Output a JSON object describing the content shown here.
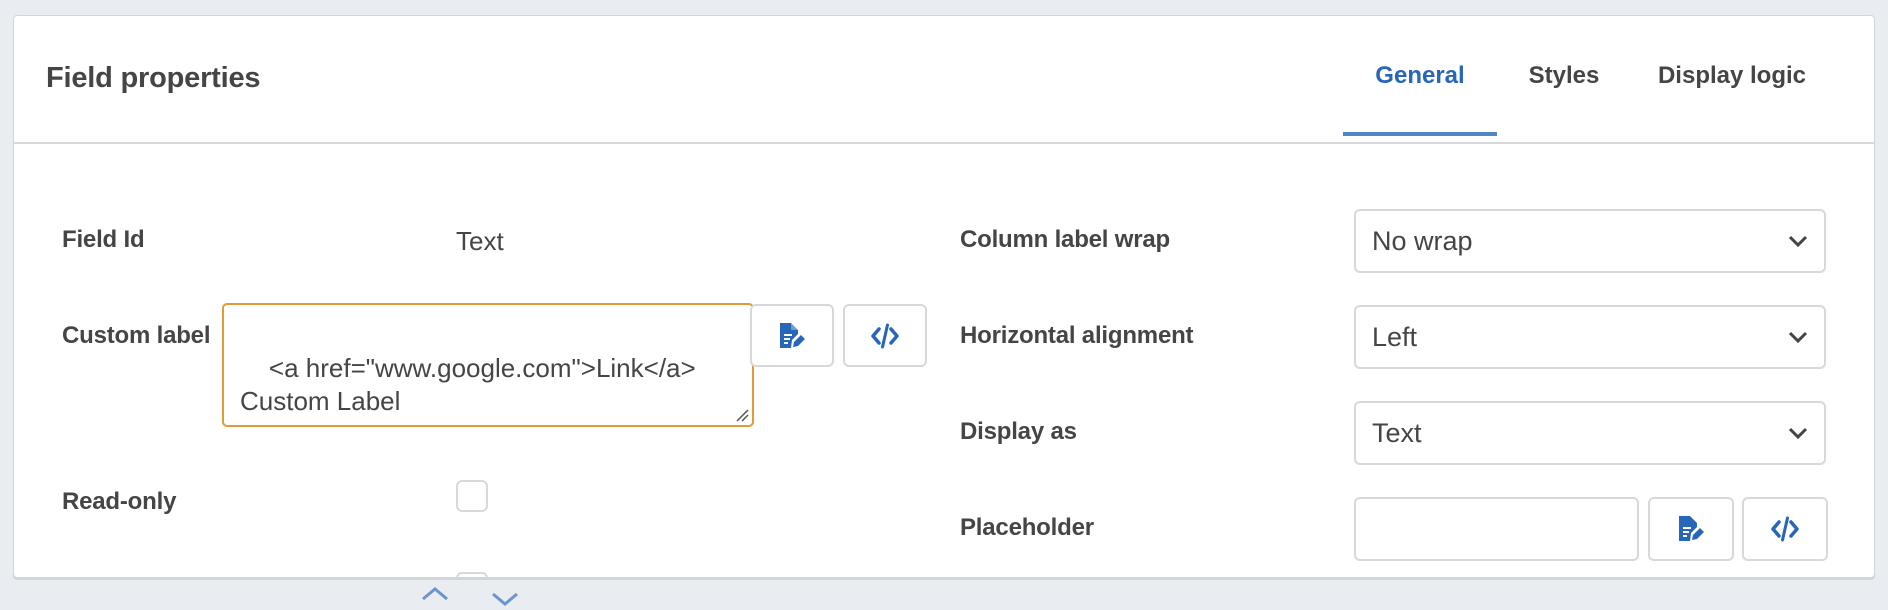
{
  "header": {
    "title": "Field properties"
  },
  "tabs": [
    {
      "label": "General",
      "active": true
    },
    {
      "label": "Styles",
      "active": false
    },
    {
      "label": "Display logic",
      "active": false
    }
  ],
  "left": {
    "field_id": {
      "label": "Field Id",
      "value": "Text"
    },
    "custom_label": {
      "label": "Custom label",
      "value": "<a href=\"www.google.com\">Link</a>\nCustom Label"
    },
    "read_only": {
      "label": "Read-only",
      "checked": false
    }
  },
  "right": {
    "column_label_wrap": {
      "label": "Column label wrap",
      "value": "No wrap"
    },
    "horizontal_alignment": {
      "label": "Horizontal alignment",
      "value": "Left"
    },
    "display_as": {
      "label": "Display as",
      "value": "Text"
    },
    "placeholder": {
      "label": "Placeholder",
      "value": ""
    }
  },
  "icons": {
    "edit": "document-edit-icon",
    "code": "code-icon",
    "chevron": "chevron-down-icon"
  },
  "colors": {
    "accent": "#2766b8",
    "tab_underline": "#4f86c8",
    "focus_border": "#e09a36",
    "border": "#d6d8dc",
    "background": "#e9edf1"
  }
}
